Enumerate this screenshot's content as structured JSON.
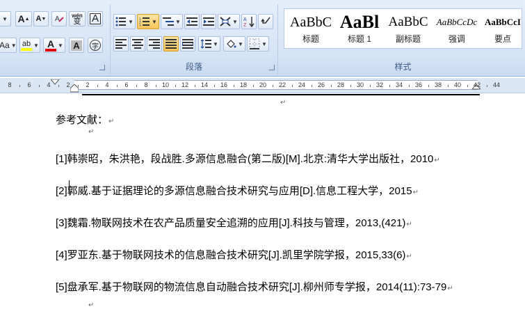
{
  "ribbon": {
    "font_group": {
      "grow_font": "A",
      "shrink_font": "A",
      "phonetic": "wén",
      "phonetic_char": "变",
      "char_border": "A",
      "char_shading": "A",
      "enclosed_char": "字",
      "aa_label": "Aa",
      "highlight_label": "ab",
      "font_color_label": "A",
      "highlight_color": "#ffff00",
      "font_color": "#e00000"
    },
    "paragraph_group": {
      "label": "段落"
    },
    "styles_group": {
      "label": "样式",
      "items": [
        {
          "preview": "AaBbC",
          "name": "标题"
        },
        {
          "preview": "AaBl",
          "name": "标题 1"
        },
        {
          "preview": "AaBbC",
          "name": "副标题"
        },
        {
          "preview": "AaBbCcDc",
          "name": "强调"
        },
        {
          "preview": "AaBbCcI",
          "name": "要点"
        }
      ]
    }
  },
  "ruler": {
    "labels": [
      "8",
      "6",
      "4",
      "2",
      "2",
      "4",
      "6",
      "8",
      "10",
      "12",
      "14",
      "16",
      "18",
      "20",
      "22",
      "24",
      "26",
      "28",
      "30",
      "32",
      "34",
      "36",
      "38",
      "40",
      "42",
      "44"
    ]
  },
  "document": {
    "mark": "↵",
    "heading": "参考文献：",
    "references": [
      "[1]韩崇昭，朱洪艳，段战胜.多源信息融合(第二版)[M].北京:清华大学出版社，2010",
      "[2]郭威.基于证据理论的多源信息融合技术研究与应用[D].信息工程大学，2015",
      "[3]魏霜.物联网技术在农产品质量安全追溯的应用[J].科技与管理，2013,(421)",
      "[4]罗亚东.基于物联网技术的信息融合技术研究[J].凯里学院学报，2015,33(6)",
      "[5]盘承军.基于物联网的物流信息自动融合技术研究[J].柳州师专学报，2014(11):73-79"
    ]
  }
}
